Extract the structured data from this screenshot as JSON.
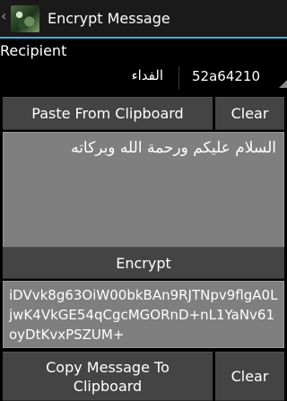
{
  "action_bar": {
    "title": "Encrypt Message",
    "back_icon": "chevron-left-icon",
    "app_icon": "camouflage-app-icon"
  },
  "recipient": {
    "label": "Recipient",
    "name": "الفداء",
    "id": "52a64210"
  },
  "buttons": {
    "paste": "Paste From Clipboard",
    "clear_top": "Clear",
    "encrypt": "Encrypt",
    "copy": "Copy Message To Clipboard",
    "clear_bottom": "Clear"
  },
  "message": {
    "value": "السلام عليكم ورحمة الله وبركاته"
  },
  "encrypted": {
    "value": "iDVvk8g63OiW00bkBAn9RJTNpv9flgA0LjwK4VkGE54qCgcMGORnD+nL1YaNv61oyDtKvxPSZUM+"
  },
  "colors": {
    "accent": "#33b5e5",
    "button_bg": "#444444",
    "field_bg": "#7f7f7f"
  }
}
